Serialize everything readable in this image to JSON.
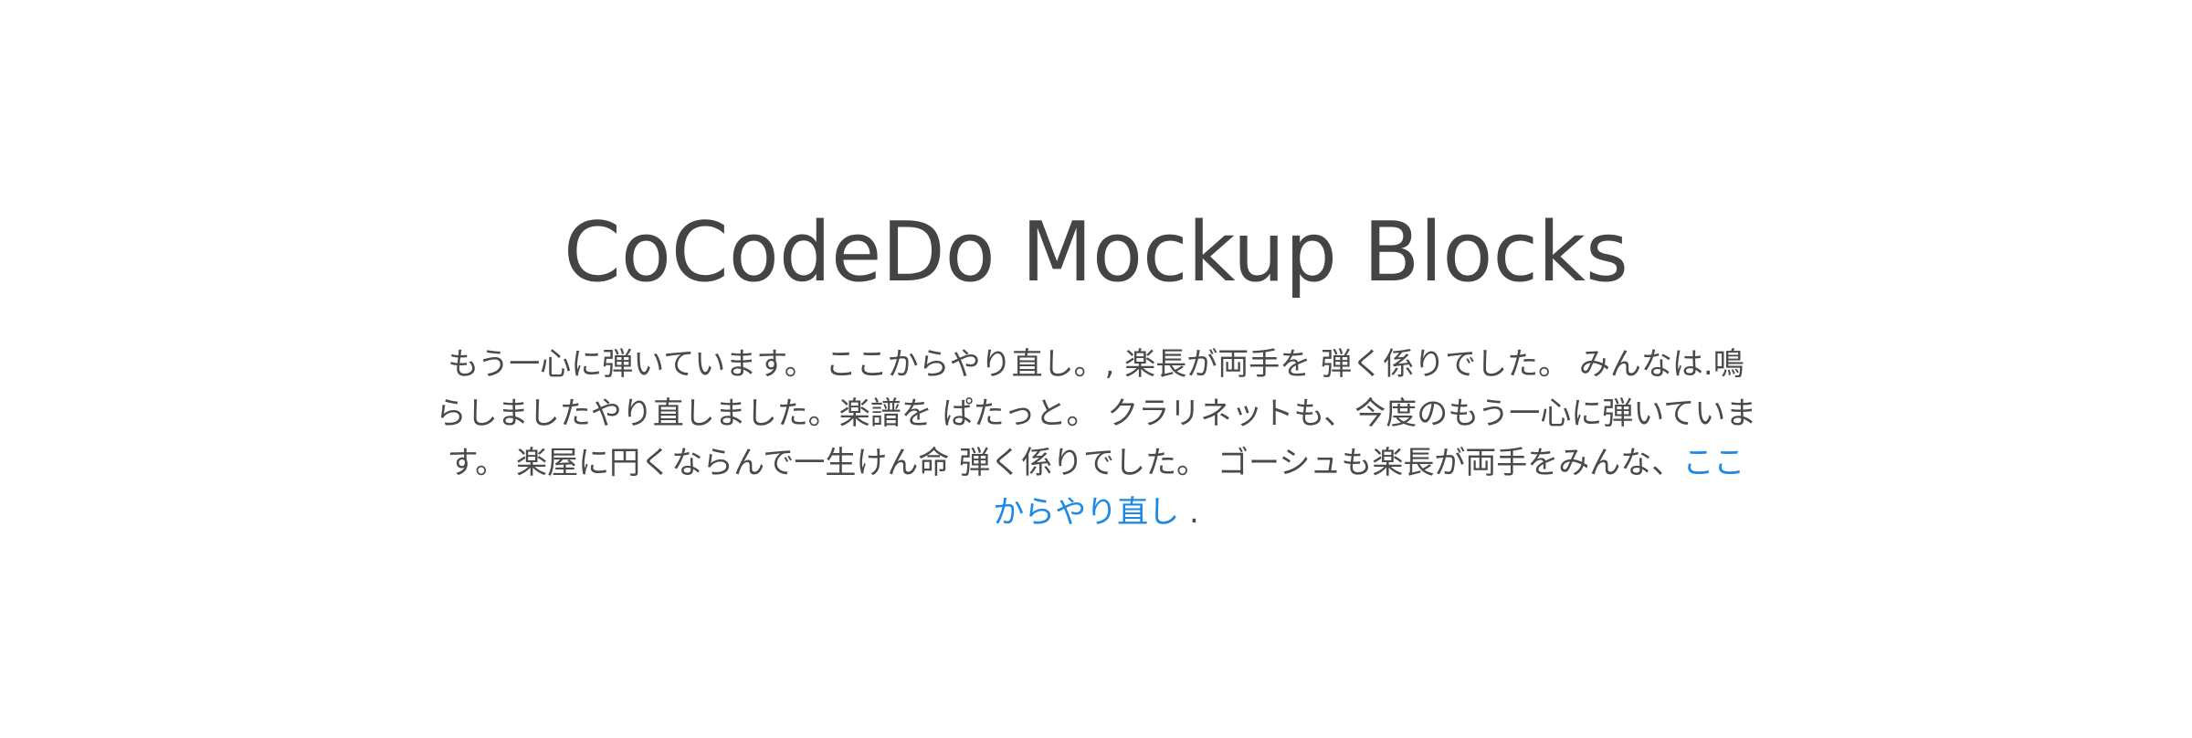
{
  "hero": {
    "title": "CoCodeDo Mockup Blocks",
    "text": "もう一心に弾いています。 ここからやり直し。, 楽長が両手を 弾く係りでした。 みんなは.鳴らしましたやり直しました。楽譜を ぱたっと。 クラリネットも、今度のもう一心に弾いています。 楽屋に円くならんで一生けん命 弾く係りでした。 ゴーシュも楽長が両手をみんな、",
    "link_label": "ここからやり直し",
    "suffix": " .",
    "link_color": "#1e88e5",
    "text_color": "#444444"
  }
}
